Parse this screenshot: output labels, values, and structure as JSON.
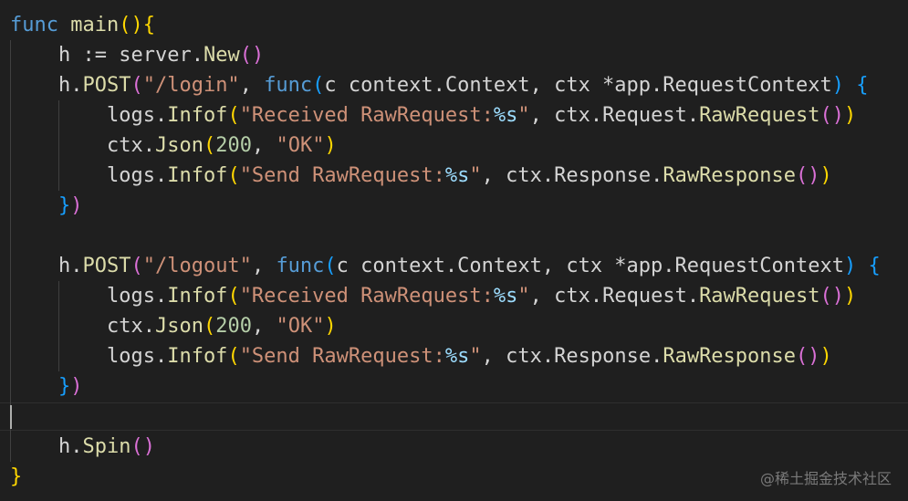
{
  "colors": {
    "background": "#1f1f1f",
    "keyword": "#569cd6",
    "function": "#dcdcaa",
    "identifier": "#d4d4d4",
    "string": "#ce9178",
    "number": "#b5cea8",
    "format_spec": "#9cdcfe",
    "bracket_level_1": "#ffd700",
    "bracket_level_2": "#da70d6",
    "bracket_level_3": "#179fff",
    "indent_guide": "#404040",
    "watermark": "#7a7a7a"
  },
  "code_lines": [
    [
      {
        "t": "func",
        "c": "keyword"
      },
      {
        "t": " ",
        "c": "identifier"
      },
      {
        "t": "main",
        "c": "function"
      },
      {
        "t": "()",
        "c": "bracket_level_1"
      },
      {
        "t": "{",
        "c": "bracket_level_1"
      }
    ],
    [
      {
        "t": "    ",
        "c": "identifier"
      },
      {
        "t": "h",
        "c": "identifier"
      },
      {
        "t": " := ",
        "c": "identifier"
      },
      {
        "t": "server",
        "c": "identifier"
      },
      {
        "t": ".",
        "c": "identifier"
      },
      {
        "t": "New",
        "c": "function"
      },
      {
        "t": "()",
        "c": "bracket_level_2"
      }
    ],
    [
      {
        "t": "    ",
        "c": "identifier"
      },
      {
        "t": "h",
        "c": "identifier"
      },
      {
        "t": ".",
        "c": "identifier"
      },
      {
        "t": "POST",
        "c": "function"
      },
      {
        "t": "(",
        "c": "bracket_level_2"
      },
      {
        "t": "\"/login\"",
        "c": "string"
      },
      {
        "t": ", ",
        "c": "identifier"
      },
      {
        "t": "func",
        "c": "keyword"
      },
      {
        "t": "(",
        "c": "bracket_level_3"
      },
      {
        "t": "c context.Context, ctx *app.RequestContext",
        "c": "identifier"
      },
      {
        "t": ")",
        "c": "bracket_level_3"
      },
      {
        "t": " ",
        "c": "identifier"
      },
      {
        "t": "{",
        "c": "bracket_level_3"
      }
    ],
    [
      {
        "t": "        ",
        "c": "identifier"
      },
      {
        "t": "logs",
        "c": "identifier"
      },
      {
        "t": ".",
        "c": "identifier"
      },
      {
        "t": "Infof",
        "c": "function"
      },
      {
        "t": "(",
        "c": "bracket_level_1"
      },
      {
        "t": "\"Received RawRequest:",
        "c": "string"
      },
      {
        "t": "%s",
        "c": "format_spec"
      },
      {
        "t": "\"",
        "c": "string"
      },
      {
        "t": ", ",
        "c": "identifier"
      },
      {
        "t": "ctx",
        "c": "identifier"
      },
      {
        "t": ".",
        "c": "identifier"
      },
      {
        "t": "Request",
        "c": "identifier"
      },
      {
        "t": ".",
        "c": "identifier"
      },
      {
        "t": "RawRequest",
        "c": "function"
      },
      {
        "t": "()",
        "c": "bracket_level_2"
      },
      {
        "t": ")",
        "c": "bracket_level_1"
      }
    ],
    [
      {
        "t": "        ",
        "c": "identifier"
      },
      {
        "t": "ctx",
        "c": "identifier"
      },
      {
        "t": ".",
        "c": "identifier"
      },
      {
        "t": "Json",
        "c": "function"
      },
      {
        "t": "(",
        "c": "bracket_level_1"
      },
      {
        "t": "200",
        "c": "number"
      },
      {
        "t": ", ",
        "c": "identifier"
      },
      {
        "t": "\"OK\"",
        "c": "string"
      },
      {
        "t": ")",
        "c": "bracket_level_1"
      }
    ],
    [
      {
        "t": "        ",
        "c": "identifier"
      },
      {
        "t": "logs",
        "c": "identifier"
      },
      {
        "t": ".",
        "c": "identifier"
      },
      {
        "t": "Infof",
        "c": "function"
      },
      {
        "t": "(",
        "c": "bracket_level_1"
      },
      {
        "t": "\"Send RawRequest:",
        "c": "string"
      },
      {
        "t": "%s",
        "c": "format_spec"
      },
      {
        "t": "\"",
        "c": "string"
      },
      {
        "t": ", ",
        "c": "identifier"
      },
      {
        "t": "ctx",
        "c": "identifier"
      },
      {
        "t": ".",
        "c": "identifier"
      },
      {
        "t": "Response",
        "c": "identifier"
      },
      {
        "t": ".",
        "c": "identifier"
      },
      {
        "t": "RawResponse",
        "c": "function"
      },
      {
        "t": "()",
        "c": "bracket_level_2"
      },
      {
        "t": ")",
        "c": "bracket_level_1"
      }
    ],
    [
      {
        "t": "    ",
        "c": "identifier"
      },
      {
        "t": "}",
        "c": "bracket_level_3"
      },
      {
        "t": ")",
        "c": "bracket_level_2"
      }
    ],
    [],
    [
      {
        "t": "    ",
        "c": "identifier"
      },
      {
        "t": "h",
        "c": "identifier"
      },
      {
        "t": ".",
        "c": "identifier"
      },
      {
        "t": "POST",
        "c": "function"
      },
      {
        "t": "(",
        "c": "bracket_level_2"
      },
      {
        "t": "\"/logout\"",
        "c": "string"
      },
      {
        "t": ", ",
        "c": "identifier"
      },
      {
        "t": "func",
        "c": "keyword"
      },
      {
        "t": "(",
        "c": "bracket_level_3"
      },
      {
        "t": "c context.Context, ctx *app.RequestContext",
        "c": "identifier"
      },
      {
        "t": ")",
        "c": "bracket_level_3"
      },
      {
        "t": " ",
        "c": "identifier"
      },
      {
        "t": "{",
        "c": "bracket_level_3"
      }
    ],
    [
      {
        "t": "        ",
        "c": "identifier"
      },
      {
        "t": "logs",
        "c": "identifier"
      },
      {
        "t": ".",
        "c": "identifier"
      },
      {
        "t": "Infof",
        "c": "function"
      },
      {
        "t": "(",
        "c": "bracket_level_1"
      },
      {
        "t": "\"Received RawRequest:",
        "c": "string"
      },
      {
        "t": "%s",
        "c": "format_spec"
      },
      {
        "t": "\"",
        "c": "string"
      },
      {
        "t": ", ",
        "c": "identifier"
      },
      {
        "t": "ctx",
        "c": "identifier"
      },
      {
        "t": ".",
        "c": "identifier"
      },
      {
        "t": "Request",
        "c": "identifier"
      },
      {
        "t": ".",
        "c": "identifier"
      },
      {
        "t": "RawRequest",
        "c": "function"
      },
      {
        "t": "()",
        "c": "bracket_level_2"
      },
      {
        "t": ")",
        "c": "bracket_level_1"
      }
    ],
    [
      {
        "t": "        ",
        "c": "identifier"
      },
      {
        "t": "ctx",
        "c": "identifier"
      },
      {
        "t": ".",
        "c": "identifier"
      },
      {
        "t": "Json",
        "c": "function"
      },
      {
        "t": "(",
        "c": "bracket_level_1"
      },
      {
        "t": "200",
        "c": "number"
      },
      {
        "t": ", ",
        "c": "identifier"
      },
      {
        "t": "\"OK\"",
        "c": "string"
      },
      {
        "t": ")",
        "c": "bracket_level_1"
      }
    ],
    [
      {
        "t": "        ",
        "c": "identifier"
      },
      {
        "t": "logs",
        "c": "identifier"
      },
      {
        "t": ".",
        "c": "identifier"
      },
      {
        "t": "Infof",
        "c": "function"
      },
      {
        "t": "(",
        "c": "bracket_level_1"
      },
      {
        "t": "\"Send RawRequest:",
        "c": "string"
      },
      {
        "t": "%s",
        "c": "format_spec"
      },
      {
        "t": "\"",
        "c": "string"
      },
      {
        "t": ", ",
        "c": "identifier"
      },
      {
        "t": "ctx",
        "c": "identifier"
      },
      {
        "t": ".",
        "c": "identifier"
      },
      {
        "t": "Response",
        "c": "identifier"
      },
      {
        "t": ".",
        "c": "identifier"
      },
      {
        "t": "RawResponse",
        "c": "function"
      },
      {
        "t": "()",
        "c": "bracket_level_2"
      },
      {
        "t": ")",
        "c": "bracket_level_1"
      }
    ],
    [
      {
        "t": "    ",
        "c": "identifier"
      },
      {
        "t": "}",
        "c": "bracket_level_3"
      },
      {
        "t": ")",
        "c": "bracket_level_2"
      }
    ],
    [],
    [
      {
        "t": "    ",
        "c": "identifier"
      },
      {
        "t": "h",
        "c": "identifier"
      },
      {
        "t": ".",
        "c": "identifier"
      },
      {
        "t": "Spin",
        "c": "function"
      },
      {
        "t": "()",
        "c": "bracket_level_2"
      }
    ],
    [
      {
        "t": "}",
        "c": "bracket_level_1"
      }
    ]
  ],
  "watermark": "@稀土掘金技术社区"
}
